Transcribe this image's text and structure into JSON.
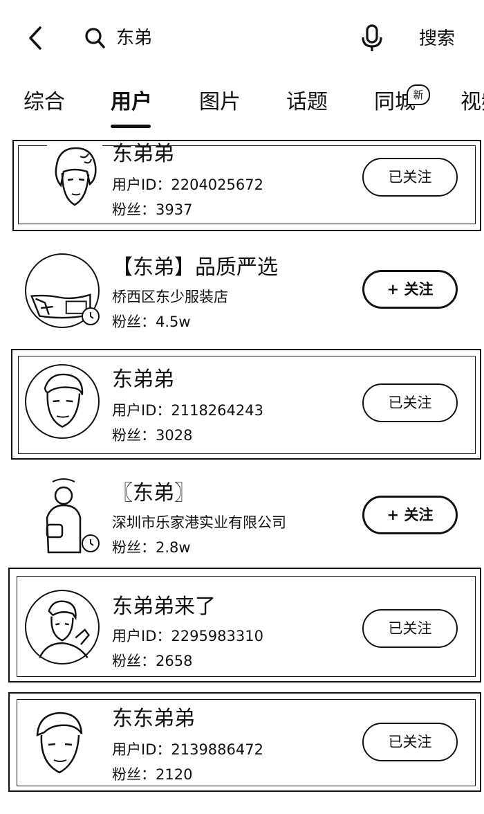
{
  "header": {
    "query": "东弟",
    "search_label": "搜索",
    "icons": [
      "back-icon",
      "search-icon",
      "mic-icon"
    ]
  },
  "tabs": [
    {
      "label": "综合",
      "active": false
    },
    {
      "label": "用户",
      "active": true
    },
    {
      "label": "图片",
      "active": false
    },
    {
      "label": "话题",
      "active": false
    },
    {
      "label": "同城",
      "active": false,
      "badge": "新"
    },
    {
      "label": "视频",
      "active": false
    }
  ],
  "results": [
    {
      "name": "东弟弟",
      "line1": "用户ID：2204025672",
      "line2": "粉丝：3937",
      "button": "已关注"
    },
    {
      "name": "【东弟】品质严选",
      "line1": "桥西区东少服装店",
      "line2": "粉丝：4.5w",
      "button": "+ 关注"
    },
    {
      "name": "东弟弟",
      "line1": "用户ID：2118264243",
      "line2": "粉丝：3028",
      "button": "已关注"
    },
    {
      "name": "〖东弟〗",
      "line1": "深圳市乐家港实业有限公司",
      "line2": "粉丝：2.8w",
      "button": "+ 关注"
    },
    {
      "name": "东弟弟来了",
      "line1": "用户ID：2295983310",
      "line2": "粉丝：2658",
      "button": "已关注"
    },
    {
      "name": "东东弟弟",
      "line1": "用户ID：2139886472",
      "line2": "粉丝：2120",
      "button": "已关注"
    }
  ]
}
